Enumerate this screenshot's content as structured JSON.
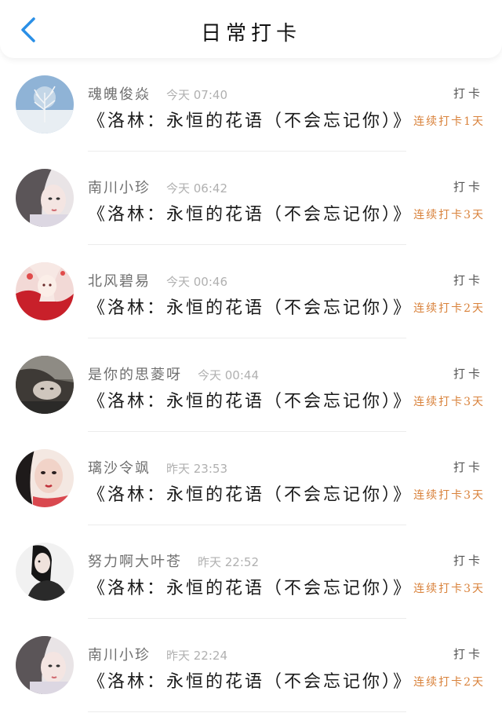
{
  "header": {
    "title": "日常打卡",
    "back_icon": "chevron-left-icon",
    "accent": "#2a8fe6"
  },
  "colors": {
    "streak": "#d9823b",
    "time": "#b0b0b0",
    "username": "#6f6f6f"
  },
  "entries": [
    {
      "user": "魂魄俊焱",
      "time": "今天 07:40",
      "book": "《洛林：永恒的花语（不会忘记你）》",
      "checkin": "打卡",
      "streak": "连续打卡1天"
    },
    {
      "user": "南川小珍",
      "time": "今天 06:42",
      "book": "《洛林：永恒的花语（不会忘记你）》",
      "checkin": "打卡",
      "streak": "连续打卡3天"
    },
    {
      "user": "北风碧易",
      "time": "今天 00:46",
      "book": "《洛林：永恒的花语（不会忘记你）》",
      "checkin": "打卡",
      "streak": "连续打卡2天"
    },
    {
      "user": "是你的思菱呀",
      "time": "今天 00:44",
      "book": "《洛林：永恒的花语（不会忘记你）》",
      "checkin": "打卡",
      "streak": "连续打卡3天"
    },
    {
      "user": "璃沙令飒",
      "time": "昨天 23:53",
      "book": "《洛林：永恒的花语（不会忘记你）》",
      "checkin": "打卡",
      "streak": "连续打卡3天"
    },
    {
      "user": "努力啊大叶苍",
      "time": "昨天 22:52",
      "book": "《洛林：永恒的花语（不会忘记你）》",
      "checkin": "打卡",
      "streak": "连续打卡3天"
    },
    {
      "user": "南川小珍",
      "time": "昨天 22:24",
      "book": "《洛林：永恒的花语（不会忘记你）》",
      "checkin": "打卡",
      "streak": "连续打卡2天"
    }
  ]
}
